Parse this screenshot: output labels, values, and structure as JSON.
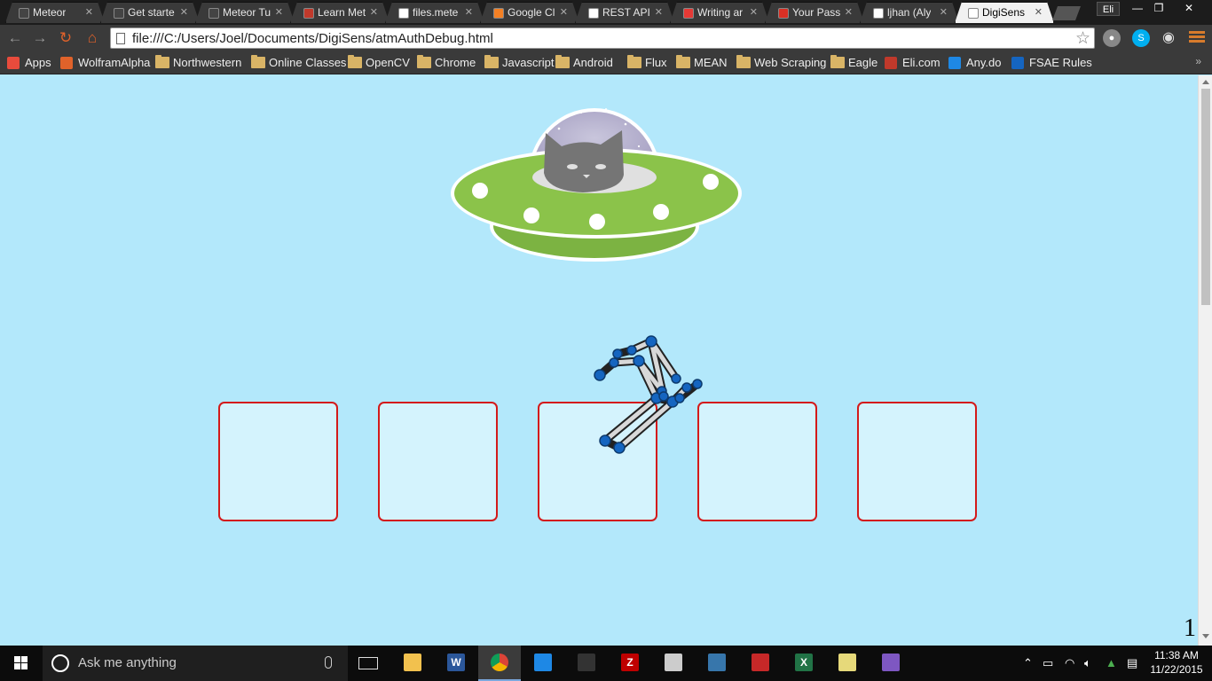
{
  "browser": {
    "tabs": [
      {
        "title": "Meteor",
        "favicon": "meteor-icon",
        "color": "#444444"
      },
      {
        "title": "Get starte",
        "favicon": "meteor-icon",
        "color": "#444444"
      },
      {
        "title": "Meteor Tu",
        "favicon": "meteor-icon",
        "color": "#444444"
      },
      {
        "title": "Learn Met",
        "favicon": "red-book-icon",
        "color": "#c0392b"
      },
      {
        "title": "files.mete",
        "favicon": "page-icon",
        "color": "#ffffff"
      },
      {
        "title": "Google Cl",
        "favicon": "stackoverflow-icon",
        "color": "#f48024"
      },
      {
        "title": "REST API",
        "favicon": "page-icon",
        "color": "#ffffff"
      },
      {
        "title": "Writing ar",
        "favicon": "c-icon",
        "color": "#e53935"
      },
      {
        "title": "Your Pass",
        "favicon": "gmail-icon",
        "color": "#d93025"
      },
      {
        "title": "ljhan (Aly",
        "favicon": "github-icon",
        "color": "#ffffff"
      },
      {
        "title": "DigiSens",
        "favicon": "page-icon",
        "color": "#ffffff",
        "active": true
      }
    ],
    "profile_label": "Eli",
    "window_controls": {
      "minimize": "—",
      "restore": "❐",
      "close": "✕"
    },
    "url": "file:///C:/Users/Joel/Documents/DigiSens/atmAuthDebug.html",
    "bookmarks": [
      {
        "label": "Apps",
        "icon": "apps-grid-icon"
      },
      {
        "label": "WolframAlpha",
        "icon": "wolfram-icon"
      },
      {
        "label": "Northwestern",
        "icon": "folder-icon"
      },
      {
        "label": "Online Classes",
        "icon": "folder-icon"
      },
      {
        "label": "OpenCV",
        "icon": "folder-icon"
      },
      {
        "label": "Chrome",
        "icon": "folder-icon"
      },
      {
        "label": "Javascript",
        "icon": "folder-icon"
      },
      {
        "label": "Android",
        "icon": "folder-icon"
      },
      {
        "label": "Flux",
        "icon": "folder-icon"
      },
      {
        "label": "MEAN",
        "icon": "folder-icon"
      },
      {
        "label": "Web Scraping",
        "icon": "folder-icon"
      },
      {
        "label": "Eagle",
        "icon": "folder-icon"
      },
      {
        "label": "Eli.com",
        "icon": "eli-site-icon"
      },
      {
        "label": "Any.do",
        "icon": "anydo-icon"
      },
      {
        "label": "FSAE Rules",
        "icon": "sae-icon"
      }
    ],
    "bookmarks_overflow": "»"
  },
  "page": {
    "background_color": "#b3e8fb",
    "slot_border_color": "#d31a1a",
    "slot_count": 5,
    "page_counter": "1"
  },
  "taskbar": {
    "search_placeholder": "Ask me anything",
    "pinned_apps": [
      {
        "name": "file-explorer",
        "icon": "folder-icon",
        "color": "#f2c14e"
      },
      {
        "name": "word",
        "icon": "word-icon",
        "color": "#2b579a",
        "glyph": "W"
      },
      {
        "name": "chrome",
        "icon": "chrome-icon",
        "color": "#4caf50",
        "active": true
      },
      {
        "name": "app-blue",
        "icon": "brackets-icon",
        "color": "#1e88e5"
      },
      {
        "name": "terminal",
        "icon": "terminal-icon",
        "color": "#333333"
      },
      {
        "name": "filezilla",
        "icon": "filezilla-icon",
        "color": "#bf0000",
        "glyph": "Z"
      },
      {
        "name": "app-gray",
        "icon": "window-icon",
        "color": "#cccccc"
      },
      {
        "name": "python",
        "icon": "python-icon",
        "color": "#3776ab"
      },
      {
        "name": "spider-app",
        "icon": "spider-icon",
        "color": "#c62828"
      },
      {
        "name": "excel",
        "icon": "excel-icon",
        "color": "#217346",
        "glyph": "X"
      },
      {
        "name": "drive-app",
        "icon": "folder-icon",
        "color": "#e6d97a"
      },
      {
        "name": "github-desktop",
        "icon": "github-cat-icon",
        "color": "#7e57c2"
      }
    ],
    "clock_time": "11:38 AM",
    "clock_date": "11/22/2015"
  }
}
